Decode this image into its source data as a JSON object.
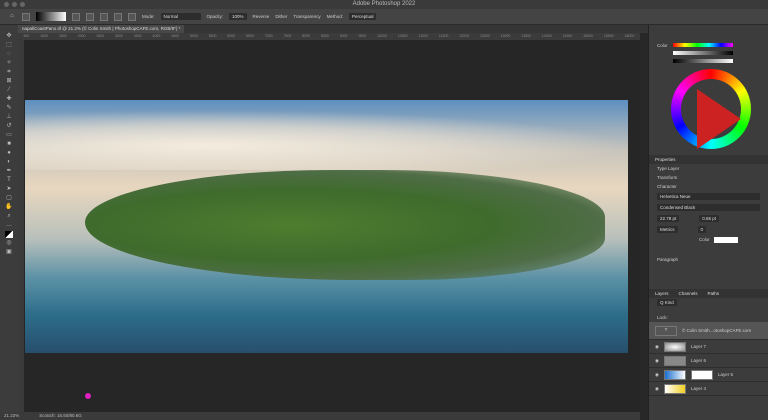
{
  "app": {
    "title": "Adobe Photoshop 2022"
  },
  "options": {
    "mode_label": "Mode:",
    "mode": "Normal",
    "opacity_label": "Opacity:",
    "opacity": "100%",
    "reverse": "Reverse",
    "dither": "Dither",
    "transparency": "Transparency",
    "method_label": "Method:",
    "method": "Perceptual"
  },
  "document": {
    "tab": "napaliCoastPano.tif @ 21.2% (© Colin Smith | PhotoshopCAFE.com, RGB/8*) *"
  },
  "ruler": [
    "500",
    "1000",
    "1500",
    "2000",
    "2500",
    "3000",
    "3500",
    "4000",
    "4500",
    "5000",
    "5500",
    "6000",
    "6500",
    "7000",
    "7500",
    "8000",
    "8500",
    "9000",
    "9500",
    "10000",
    "10500",
    "11000",
    "11500",
    "12000",
    "12500",
    "13000",
    "13500",
    "14000",
    "14500",
    "15000",
    "15500",
    "16000"
  ],
  "status": {
    "zoom": "21.22%",
    "scratch": "Scratch: 16.50/80.6G"
  },
  "color_panel": {
    "title": "Color"
  },
  "properties": {
    "title": "Properties",
    "layer_type": "Type Layer",
    "transform": "Transform",
    "character": "Character",
    "font": "Helvetica Neue",
    "style": "Condensed Black",
    "size": "22.78 pt",
    "leading": "0.65 pt",
    "kerning": "Metrics",
    "tracking": "0",
    "color_label": "Color",
    "paragraph": "Paragraph"
  },
  "layers_panel": {
    "tabs": [
      "Layers",
      "Channels",
      "Paths"
    ],
    "filter": "Q Kind",
    "lock_label": "Lock:",
    "layers": [
      {
        "name": "© Colin Smith...otoshopCAFE.com"
      },
      {
        "name": "Layer 7"
      },
      {
        "name": "Layer 6"
      },
      {
        "name": "Layer 5"
      },
      {
        "name": "Layer 4"
      }
    ]
  }
}
